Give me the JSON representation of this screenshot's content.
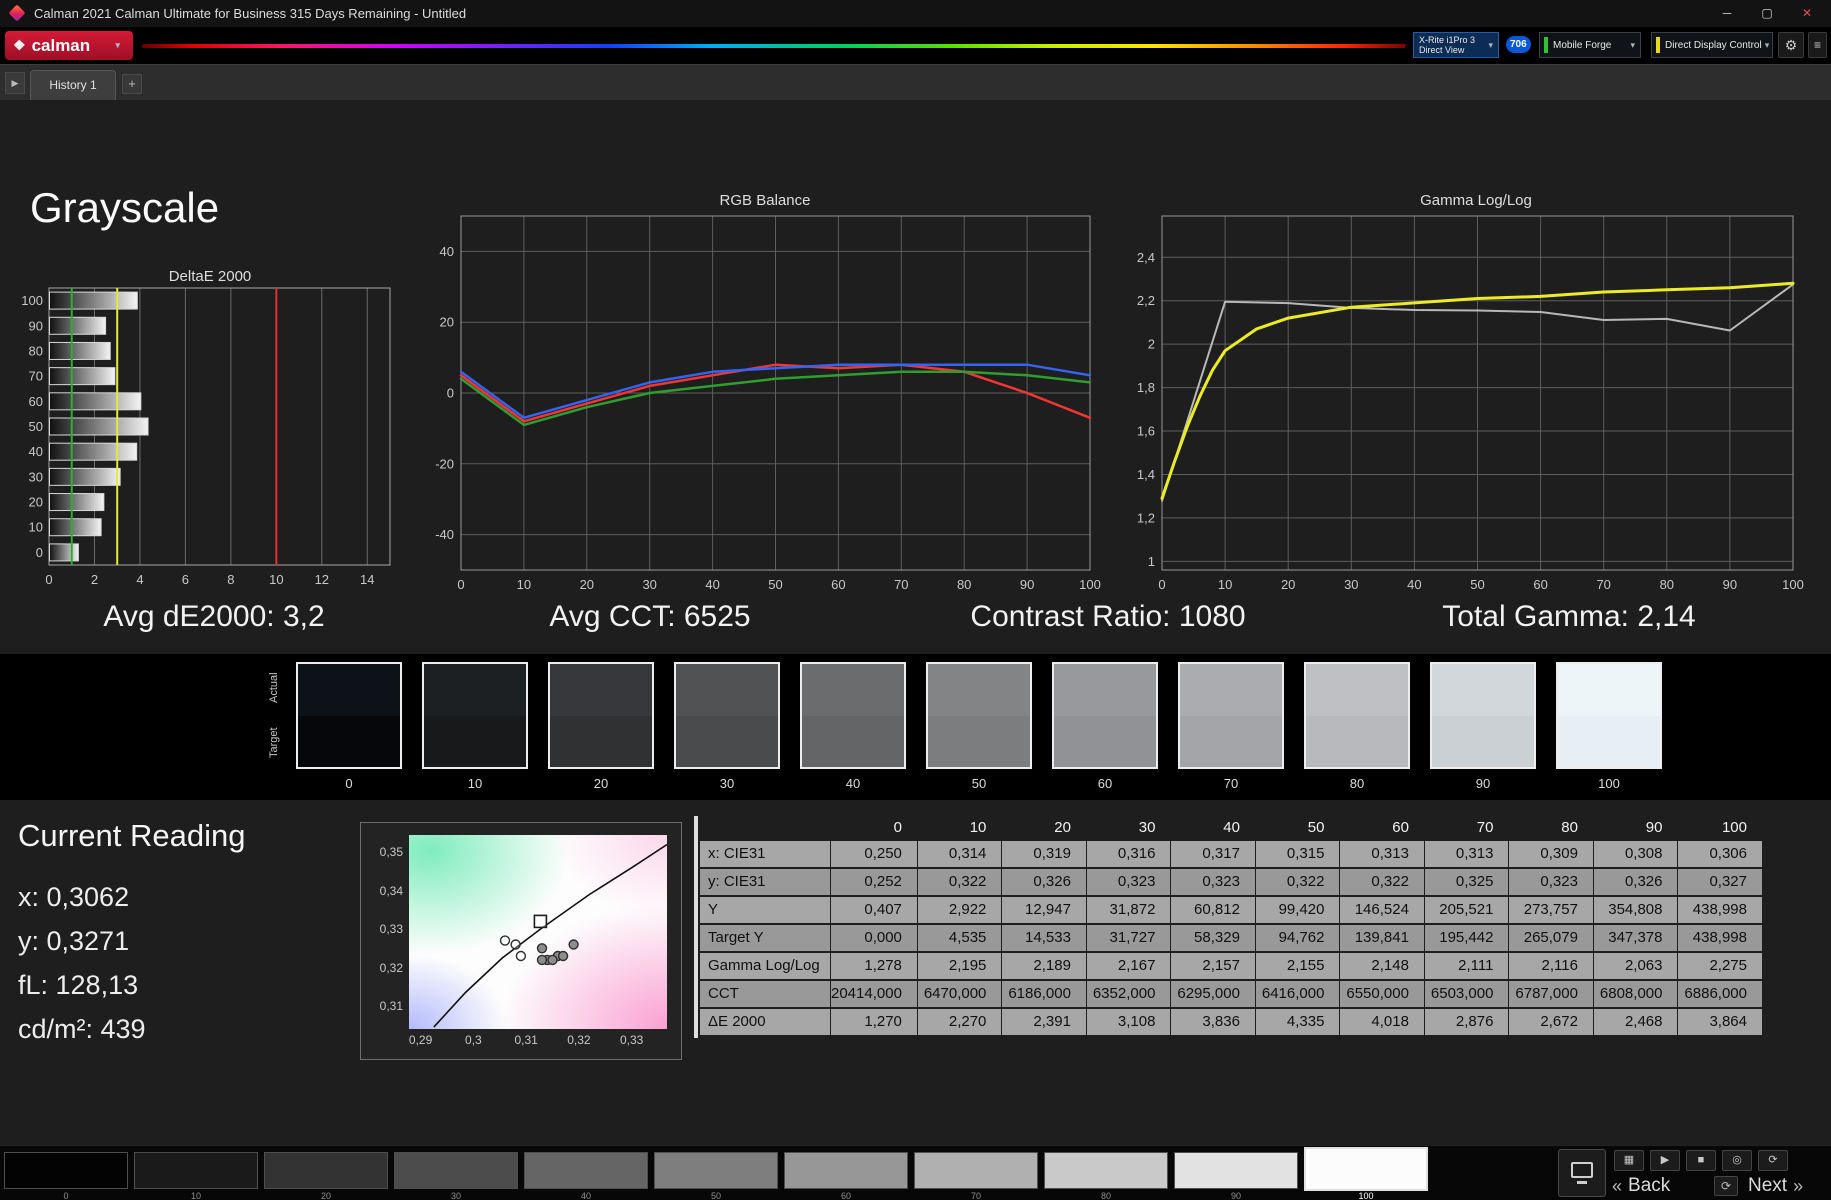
{
  "window": {
    "title": "Calman 2021 Calman Ultimate for Business 315 Days Remaining - Untitled"
  },
  "icons": {
    "dropdown_arrow": "▾",
    "minimize": "─",
    "maximize": "▢",
    "close": "✕",
    "gear": "⚙",
    "menu": "≡",
    "tab_arrow": "▶",
    "add_tab": "+",
    "logo_gem": "❖",
    "back_chevrons": "«",
    "next_chevrons": "»",
    "small_buttons": [
      "▦",
      "▶",
      "■",
      "◎",
      "⟳"
    ]
  },
  "toolbar": {
    "logo_text": "calman",
    "meter_line1": "X-Rite i1Pro 3",
    "meter_line2": "Direct View",
    "badge": "706",
    "source_label": "Mobile Forge",
    "display_label": "Direct Display Control"
  },
  "tabs": {
    "active": "History 1"
  },
  "page": {
    "title": "Grayscale"
  },
  "stats": {
    "avg_de": "Avg dE2000: 3,2",
    "avg_cct": "Avg CCT: 6525",
    "contrast": "Contrast Ratio: 1080",
    "total_gamma": "Total Gamma: 2,14"
  },
  "grayscale_strip": {
    "row_labels": [
      "Actual",
      "Target"
    ],
    "levels": [
      "0",
      "10",
      "20",
      "30",
      "40",
      "50",
      "60",
      "70",
      "80",
      "90",
      "100"
    ],
    "actual_colors": [
      "#0c1218",
      "#1d2023",
      "#36383b",
      "#505254",
      "#6a6c6e",
      "#828486",
      "#97999c",
      "#aaacaf",
      "#bec0c3",
      "#d2d7db",
      "#eef5f9"
    ],
    "target_colors": [
      "#05070a",
      "#17191b",
      "#2f3133",
      "#494b4d",
      "#636567",
      "#7b7d7f",
      "#909295",
      "#a3a5a8",
      "#b7b9bc",
      "#cbd0d4",
      "#e7eff4"
    ]
  },
  "current_reading": {
    "title": "Current Reading",
    "lines": [
      "x: 0,3062",
      "y: 0,3271",
      "fL: 128,13",
      "cd/m²: 439"
    ]
  },
  "table": {
    "columns": [
      "0",
      "10",
      "20",
      "30",
      "40",
      "50",
      "60",
      "70",
      "80",
      "90",
      "100"
    ],
    "rows": [
      {
        "label": "x: CIE31",
        "values": [
          "0,250",
          "0,314",
          "0,319",
          "0,316",
          "0,317",
          "0,315",
          "0,313",
          "0,313",
          "0,309",
          "0,308",
          "0,306"
        ]
      },
      {
        "label": "y: CIE31",
        "values": [
          "0,252",
          "0,322",
          "0,326",
          "0,323",
          "0,323",
          "0,322",
          "0,322",
          "0,325",
          "0,323",
          "0,326",
          "0,327"
        ]
      },
      {
        "label": "Y",
        "values": [
          "0,407",
          "2,922",
          "12,947",
          "31,872",
          "60,812",
          "99,420",
          "146,524",
          "205,521",
          "273,757",
          "354,808",
          "438,998"
        ]
      },
      {
        "label": "Target Y",
        "values": [
          "0,000",
          "4,535",
          "14,533",
          "31,727",
          "58,329",
          "94,762",
          "139,841",
          "195,442",
          "265,079",
          "347,378",
          "438,998"
        ]
      },
      {
        "label": "Gamma Log/Log",
        "values": [
          "1,278",
          "2,195",
          "2,189",
          "2,167",
          "2,157",
          "2,155",
          "2,148",
          "2,111",
          "2,116",
          "2,063",
          "2,275"
        ]
      },
      {
        "label": "CCT",
        "values": [
          "20414,000",
          "6470,000",
          "6186,000",
          "6352,000",
          "6295,000",
          "6416,000",
          "6550,000",
          "6503,000",
          "6787,000",
          "6808,000",
          "6886,000"
        ]
      },
      {
        "label": "ΔE 2000",
        "values": [
          "1,270",
          "2,270",
          "2,391",
          "3,108",
          "3,836",
          "4,335",
          "4,018",
          "2,876",
          "2,672",
          "2,468",
          "3,864"
        ]
      }
    ]
  },
  "bottom_bar": {
    "levels": [
      "0",
      "10",
      "20",
      "30",
      "40",
      "50",
      "60",
      "70",
      "80",
      "90",
      "100"
    ],
    "colors": [
      "#030303",
      "#1a1a1a",
      "#333333",
      "#4c4c4c",
      "#656565",
      "#7e7e7e",
      "#979797",
      "#b0b0b0",
      "#c9c9c9",
      "#e2e2e2",
      "#fcfcfc"
    ],
    "selected": "100",
    "back_label": "Back",
    "next_label": "Next"
  },
  "chart_data": [
    {
      "type": "bar",
      "title": "DeltaE 2000",
      "orientation": "horizontal",
      "categories": [
        "100",
        "90",
        "80",
        "70",
        "60",
        "50",
        "40",
        "30",
        "20",
        "10",
        "0"
      ],
      "values": [
        3.864,
        2.468,
        2.672,
        2.876,
        4.018,
        4.335,
        3.836,
        3.108,
        2.391,
        2.27,
        1.27
      ],
      "xlim": [
        0,
        15
      ],
      "xticks": [
        0,
        2,
        4,
        6,
        8,
        10,
        12,
        14
      ],
      "xlabel": "",
      "ylabel": "",
      "reference_lines": [
        {
          "x": 1,
          "color": "#2fae2f",
          "name": "green-reference-line"
        },
        {
          "x": 3,
          "color": "#e8e832",
          "name": "yellow-reference-line"
        },
        {
          "x": 10,
          "color": "#e03232",
          "name": "red-reference-line"
        }
      ]
    },
    {
      "type": "line",
      "title": "RGB Balance",
      "x": [
        0,
        10,
        20,
        30,
        40,
        50,
        60,
        70,
        80,
        90,
        100
      ],
      "series": [
        {
          "name": "Red",
          "color": "#f23535",
          "values": [
            5,
            -8,
            -3,
            2,
            5,
            8,
            7,
            8,
            6,
            0,
            -7
          ]
        },
        {
          "name": "Green",
          "color": "#2f9e2f",
          "values": [
            4,
            -9,
            -4,
            0,
            2,
            4,
            5,
            6,
            6,
            5,
            3
          ]
        },
        {
          "name": "Blue",
          "color": "#3563f2",
          "values": [
            6,
            -7,
            -2,
            3,
            6,
            7,
            8,
            8,
            8,
            8,
            5
          ]
        }
      ],
      "ylim": [
        -50,
        50
      ],
      "yticks": [
        40,
        20,
        0,
        -20,
        -40
      ],
      "xticks": [
        0,
        10,
        20,
        30,
        40,
        50,
        60,
        70,
        80,
        90,
        100
      ],
      "legend": "none",
      "grid": true
    },
    {
      "type": "line",
      "title": "Gamma Log/Log",
      "series": [
        {
          "name": "Measured",
          "color": "#b8b8b8",
          "width": 2,
          "x": [
            0,
            10,
            20,
            30,
            40,
            50,
            60,
            70,
            80,
            90,
            100
          ],
          "values": [
            1.278,
            2.195,
            2.189,
            2.167,
            2.157,
            2.155,
            2.148,
            2.111,
            2.116,
            2.063,
            2.275
          ]
        },
        {
          "name": "Gamma",
          "color": "#ecec25",
          "width": 3,
          "x": [
            0,
            2,
            4,
            6,
            8,
            10,
            15,
            20,
            30,
            40,
            50,
            60,
            70,
            80,
            90,
            100
          ],
          "values": [
            1.29,
            1.46,
            1.62,
            1.76,
            1.88,
            1.97,
            2.07,
            2.12,
            2.17,
            2.19,
            2.21,
            2.22,
            2.24,
            2.25,
            2.26,
            2.28
          ]
        }
      ],
      "ylim": [
        0.96,
        2.59
      ],
      "yticks": [
        2.4,
        2.2,
        2.0,
        1.8,
        1.6,
        1.4,
        1.2,
        1.0
      ],
      "ytick_labels": [
        "2,4",
        "2,2",
        "2",
        "1,8",
        "1,6",
        "1,4",
        "1,2",
        "1"
      ],
      "xticks": [
        0,
        10,
        20,
        30,
        40,
        50,
        60,
        70,
        80,
        90,
        100
      ],
      "legend": "none",
      "grid": true
    },
    {
      "type": "scatter",
      "title": "CIE xy chromaticity",
      "xlim": [
        0.2878,
        0.3367
      ],
      "ylim": [
        0.304,
        0.3545
      ],
      "xticks": [
        {
          "v": 0.29,
          "label": "0,29"
        },
        {
          "v": 0.3,
          "label": "0,3"
        },
        {
          "v": 0.31,
          "label": "0,31"
        },
        {
          "v": 0.32,
          "label": "0,32"
        },
        {
          "v": 0.33,
          "label": "0,33"
        }
      ],
      "yticks": [
        {
          "v": 0.35,
          "label": "0,35"
        },
        {
          "v": 0.34,
          "label": "0,34"
        },
        {
          "v": 0.33,
          "label": "0,33"
        },
        {
          "v": 0.32,
          "label": "0,32"
        },
        {
          "v": 0.31,
          "label": "0,31"
        }
      ],
      "locus": [
        [
          0.2925,
          0.3045
        ],
        [
          0.2985,
          0.3135
        ],
        [
          0.3055,
          0.3225
        ],
        [
          0.3127,
          0.33
        ],
        [
          0.322,
          0.339
        ],
        [
          0.33,
          0.346
        ],
        [
          0.3367,
          0.352
        ]
      ],
      "points": [
        {
          "x": 0.314,
          "y": 0.322
        },
        {
          "x": 0.319,
          "y": 0.326
        },
        {
          "x": 0.316,
          "y": 0.323
        },
        {
          "x": 0.317,
          "y": 0.323
        },
        {
          "x": 0.315,
          "y": 0.322
        },
        {
          "x": 0.313,
          "y": 0.322
        },
        {
          "x": 0.313,
          "y": 0.325
        },
        {
          "x": 0.309,
          "y": 0.323,
          "open": true
        },
        {
          "x": 0.308,
          "y": 0.326,
          "open": true
        },
        {
          "x": 0.306,
          "y": 0.327,
          "open": true
        }
      ],
      "target": {
        "x": 0.3127,
        "y": 0.332
      }
    }
  ]
}
